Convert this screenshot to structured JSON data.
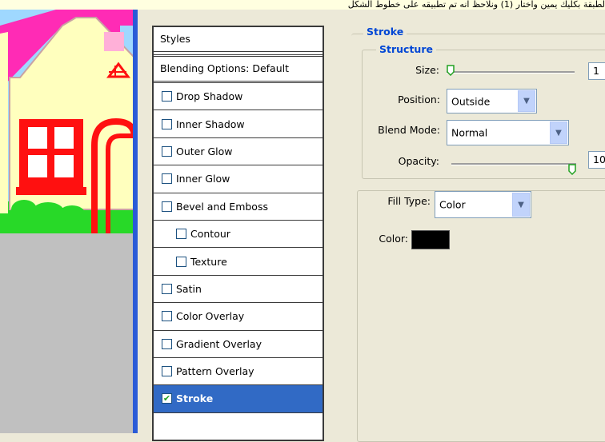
{
  "top_strip_text": "لطبقة بكليك يمين واختار (1) ونلاحظ انه تم تطبيقه على خطوط الشكل",
  "styles_panel": {
    "header": "Styles",
    "blending": "Blending Options: Default",
    "items": [
      {
        "label": "Drop Shadow",
        "checked": false
      },
      {
        "label": "Inner Shadow",
        "checked": false
      },
      {
        "label": "Outer Glow",
        "checked": false
      },
      {
        "label": "Inner Glow",
        "checked": false
      },
      {
        "label": "Bevel and Emboss",
        "checked": false
      },
      {
        "label": "Contour",
        "checked": false
      },
      {
        "label": "Texture",
        "checked": false
      },
      {
        "label": "Satin",
        "checked": false
      },
      {
        "label": "Color Overlay",
        "checked": false
      },
      {
        "label": "Gradient Overlay",
        "checked": false
      },
      {
        "label": "Pattern Overlay",
        "checked": false
      },
      {
        "label": "Stroke",
        "checked": true
      }
    ],
    "checkmark": "✔"
  },
  "stroke": {
    "title": "Stroke",
    "structure_title": "Structure",
    "size_label": "Size:",
    "size_value": "1",
    "size_fraction": 0.0,
    "position_label": "Position:",
    "position_value": "Outside",
    "blend_label": "Blend Mode:",
    "blend_value": "Normal",
    "opacity_label": "Opacity:",
    "opacity_value": "10",
    "opacity_fraction": 1.0,
    "fill_type_label": "Fill Type:",
    "fill_type_value": "Color",
    "color_label": "Color:",
    "color_value": "#000000"
  },
  "icons": {
    "dropdown": "chevron-down-icon",
    "slider": "slider-thumb-icon"
  },
  "colors": {
    "selection": "#316ac5",
    "legend": "#0046d5",
    "dialog_bg": "#ece9d8",
    "window_border": "#2a5bd7"
  }
}
